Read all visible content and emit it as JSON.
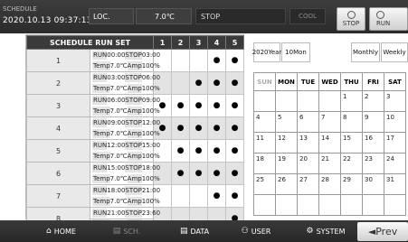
{
  "topbar": {
    "label": "SCHEDULE",
    "datetime": "2020.10.13 09:37:13",
    "loc_label": "LOC.",
    "temp": "7.0℃",
    "status": "STOP",
    "mode": "COOL",
    "stop_button": "STOP",
    "run_button": "RUN"
  },
  "schedule": {
    "title": "SCHEDULE RUN SET",
    "day_headers": [
      "1",
      "2",
      "3",
      "4",
      "5"
    ],
    "run_label": "RUN",
    "stop_label": "STOP",
    "temp_label": "Temp",
    "amp_label": "Amp",
    "dot": "●",
    "rows": [
      {
        "num": "1",
        "run": "00:00",
        "stop": "03:00",
        "temp": "7.0℃",
        "amp": "100%",
        "days": [
          false,
          false,
          false,
          true,
          true
        ]
      },
      {
        "num": "2",
        "run": "03:00",
        "stop": "06:00",
        "temp": "7.0℃",
        "amp": "100%",
        "days": [
          false,
          false,
          true,
          true,
          true
        ]
      },
      {
        "num": "3",
        "run": "06:00",
        "stop": "09:00",
        "temp": "7.0℃",
        "amp": "100%",
        "days": [
          true,
          true,
          true,
          true,
          true
        ]
      },
      {
        "num": "4",
        "run": "09:00",
        "stop": "12:00",
        "temp": "7.0℃",
        "amp": "100%",
        "days": [
          true,
          true,
          true,
          true,
          true
        ]
      },
      {
        "num": "5",
        "run": "12:00",
        "stop": "15:00",
        "temp": "7.0℃",
        "amp": "100%",
        "days": [
          false,
          true,
          true,
          true,
          true
        ]
      },
      {
        "num": "6",
        "run": "15:00",
        "stop": "18:00",
        "temp": "7.0℃",
        "amp": "100%",
        "days": [
          false,
          true,
          true,
          true,
          true
        ]
      },
      {
        "num": "7",
        "run": "18:00",
        "stop": "21:00",
        "temp": "7.0℃",
        "amp": "100%",
        "days": [
          false,
          false,
          false,
          true,
          true
        ]
      },
      {
        "num": "8",
        "run": "21:00",
        "stop": "23:60",
        "temp": "7.0℃",
        "amp": "100%",
        "days": [
          false,
          false,
          false,
          false,
          true
        ]
      }
    ]
  },
  "calendar": {
    "year": "2020Year",
    "month": "10Mon",
    "monthly": "Monthly",
    "weekly": "Weekly",
    "weekdays": [
      "SUN",
      "MON",
      "TUE",
      "WED",
      "THU",
      "FRI",
      "SAT"
    ],
    "weeks": [
      [
        "",
        "",
        "",
        "",
        "1",
        "2",
        "3"
      ],
      [
        "4",
        "5",
        "6",
        "7",
        "8",
        "9",
        "10"
      ],
      [
        "11",
        "12",
        "13",
        "14",
        "15",
        "16",
        "17"
      ],
      [
        "18",
        "19",
        "20",
        "21",
        "22",
        "23",
        "24"
      ],
      [
        "25",
        "26",
        "27",
        "28",
        "29",
        "30",
        "31"
      ],
      [
        "",
        "",
        "",
        "",
        "",
        "",
        ""
      ]
    ]
  },
  "nav": {
    "home": "HOME",
    "sch": "SCH.",
    "data": "DATA",
    "user": "USER",
    "system": "SYSTEM",
    "prev": "◄Prev"
  }
}
